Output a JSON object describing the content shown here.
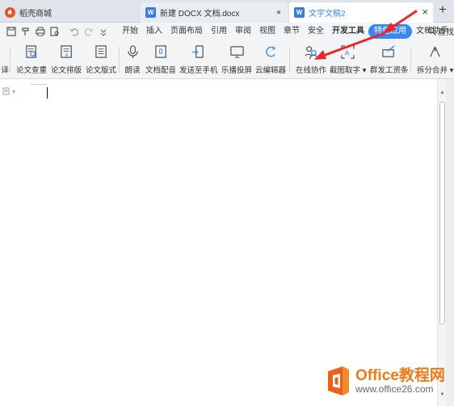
{
  "tabs": [
    {
      "label": "稻壳商城"
    },
    {
      "label": "新建 DOCX 文档.docx"
    },
    {
      "label": "文字文稿2"
    }
  ],
  "tab_icons": [
    "W",
    "W"
  ],
  "tab_dot": "●",
  "tab_close": "×",
  "new_tab": "+",
  "menu": {
    "items": [
      "开始",
      "插入",
      "页面布局",
      "引用",
      "审阅",
      "视图",
      "章节",
      "安全",
      "开发工具",
      "特色应用",
      "文档助手"
    ],
    "active": "特色应用",
    "search_label": "查找"
  },
  "ribbon": {
    "items": [
      {
        "label": "译"
      },
      {
        "label": "论文查重"
      },
      {
        "label": "论文排版"
      },
      {
        "label": "论文版式"
      },
      {
        "label": "朗读"
      },
      {
        "label": "文档配音"
      },
      {
        "label": "发送至手机"
      },
      {
        "label": "乐播投屏"
      },
      {
        "label": "云编辑器"
      },
      {
        "label": "在线协作"
      },
      {
        "label": "截图取字 ▾"
      },
      {
        "label": "群发工资条"
      },
      {
        "label": "拆分合并 ▾"
      }
    ]
  },
  "doc": {
    "marker_caret": "▾"
  },
  "scrollbar": {
    "up": "▲",
    "down": "▼"
  },
  "watermark": {
    "title": "Office教程网",
    "url": "www.office26.com"
  },
  "colors": {
    "accent": "#3b86f0",
    "arrow": "#e8262a",
    "watermark_orange": "#e97b1b"
  }
}
